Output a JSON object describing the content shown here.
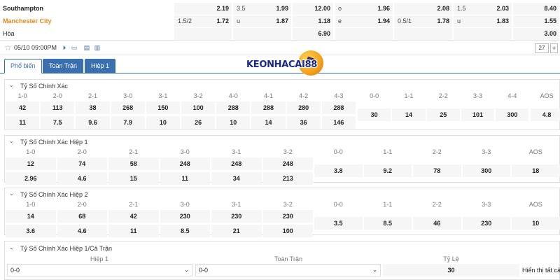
{
  "odds": {
    "rows": [
      {
        "team": "Southampton",
        "cells": [
          {
            "label": "",
            "value": "2.19"
          },
          {
            "label": "3.5",
            "value": "1.99"
          },
          {
            "label": "",
            "value": "12.00"
          },
          {
            "label": "o",
            "value": "1.96"
          },
          {
            "label": "",
            "value": "2.08"
          },
          {
            "label": "1.5",
            "value": "2.03"
          },
          {
            "label": "",
            "value": "8.40"
          }
        ]
      },
      {
        "team": "Manchester City",
        "cells": [
          {
            "label": "1.5/2",
            "value": "1.72"
          },
          {
            "label": "u",
            "value": "1.87"
          },
          {
            "label": "",
            "value": "1.18"
          },
          {
            "label": "e",
            "value": "1.94"
          },
          {
            "label": "0.5/1",
            "value": "1.78"
          },
          {
            "label": "u",
            "value": "1.83"
          },
          {
            "label": "",
            "value": "1.55"
          }
        ]
      },
      {
        "team": "Hòa",
        "cells": [
          {
            "label": "",
            "value": ""
          },
          {
            "label": "",
            "value": ""
          },
          {
            "label": "",
            "value": "6.90"
          },
          {
            "label": "",
            "value": ""
          },
          {
            "label": "",
            "value": ""
          },
          {
            "label": "",
            "value": ""
          },
          {
            "label": "",
            "value": "3.00"
          }
        ]
      }
    ]
  },
  "info": {
    "date": "05/10 09:00PM",
    "count": "27",
    "plus": "+"
  },
  "tabs": [
    {
      "label": "Phổ biến"
    },
    {
      "label": "Toàn Trận"
    },
    {
      "label": "Hiệp 1"
    }
  ],
  "logo": {
    "text": "KEONHACAI88"
  },
  "sections": [
    {
      "title": "Tỷ Số Chính Xác",
      "cols": [
        {
          "label": "1-0",
          "v1": "42",
          "v2": "11"
        },
        {
          "label": "2-0",
          "v1": "113",
          "v2": "7.5"
        },
        {
          "label": "2-1",
          "v1": "38",
          "v2": "9.6"
        },
        {
          "label": "3-0",
          "v1": "268",
          "v2": "7.9"
        },
        {
          "label": "3-1",
          "v1": "150",
          "v2": "10"
        },
        {
          "label": "3-2",
          "v1": "100",
          "v2": "26"
        },
        {
          "label": "4-0",
          "v1": "288",
          "v2": "10"
        },
        {
          "label": "4-1",
          "v1": "288",
          "v2": "14"
        },
        {
          "label": "4-2",
          "v1": "280",
          "v2": "36"
        },
        {
          "label": "4-3",
          "v1": "288",
          "v2": "146"
        },
        {
          "label": "0-0",
          "v": "30"
        },
        {
          "label": "1-1",
          "v": "14"
        },
        {
          "label": "2-2",
          "v": "25"
        },
        {
          "label": "3-3",
          "v": "101"
        },
        {
          "label": "4-4",
          "v": "300"
        },
        {
          "label": "AOS",
          "v": "4.8"
        }
      ]
    },
    {
      "title": "Tỷ Số Chính Xác Hiệp 1",
      "cols": [
        {
          "label": "1-0",
          "v1": "12",
          "v2": "2.96"
        },
        {
          "label": "2-0",
          "v1": "74",
          "v2": "4.6"
        },
        {
          "label": "2-1",
          "v1": "58",
          "v2": "15"
        },
        {
          "label": "3-0",
          "v1": "248",
          "v2": "11"
        },
        {
          "label": "3-1",
          "v1": "248",
          "v2": "34"
        },
        {
          "label": "3-2",
          "v1": "248",
          "v2": "213"
        },
        {
          "label": "0-0",
          "v": "3.8"
        },
        {
          "label": "1-1",
          "v": "9.2"
        },
        {
          "label": "2-2",
          "v": "78"
        },
        {
          "label": "3-3",
          "v": "300"
        },
        {
          "label": "AOS",
          "v": "18"
        }
      ]
    },
    {
      "title": "Tỷ Số Chính Xác Hiệp 2",
      "cols": [
        {
          "label": "1-0",
          "v1": "14",
          "v2": "3.6"
        },
        {
          "label": "2-0",
          "v1": "68",
          "v2": "4.6"
        },
        {
          "label": "2-1",
          "v1": "42",
          "v2": "11"
        },
        {
          "label": "3-0",
          "v1": "230",
          "v2": "8.5"
        },
        {
          "label": "3-1",
          "v1": "230",
          "v2": "21"
        },
        {
          "label": "3-2",
          "v1": "230",
          "v2": "100"
        },
        {
          "label": "0-0",
          "v": "3.5"
        },
        {
          "label": "1-1",
          "v": "8.5"
        },
        {
          "label": "2-2",
          "v": "46"
        },
        {
          "label": "3-3",
          "v": "230"
        },
        {
          "label": "AOS",
          "v": "10"
        }
      ]
    }
  ],
  "htft": {
    "title": "Tỷ Số Chính Xác Hiệp 1/Cả Trận",
    "h1_label": "Hiệp 1",
    "ft_label": "Toàn Trận",
    "rate_label": "Tỷ Lệ",
    "h1_value": "0-0",
    "ft_value": "0-0",
    "rate_value": "30",
    "show_all": "Hiển thị tất cả"
  }
}
